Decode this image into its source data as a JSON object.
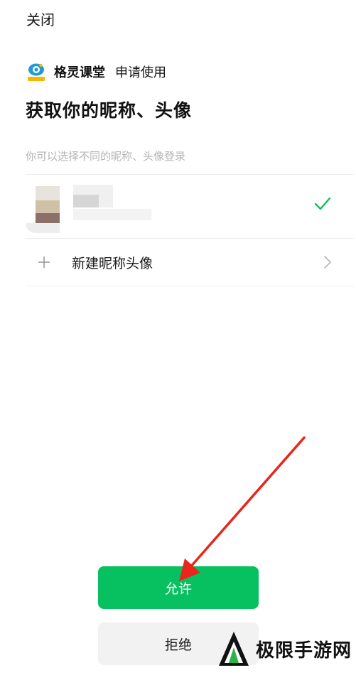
{
  "header": {
    "close_label": "关闭"
  },
  "app": {
    "name": "格灵课堂",
    "request_text": "申请使用",
    "logo_icon": "eye-logo-icon",
    "logo_color": "#1e9bd7"
  },
  "auth": {
    "title": "获取你的昵称、头像",
    "subtitle": "你可以选择不同的昵称、头像登录",
    "selected_check_icon": "check-icon",
    "accent_color": "#07c160"
  },
  "new_profile": {
    "label": "新建昵称头像",
    "icon": "plus-icon",
    "chevron": "chevron-right-icon"
  },
  "actions": {
    "allow_label": "允许",
    "reject_label": "拒绝"
  },
  "watermark": {
    "text": "极限手游网"
  }
}
